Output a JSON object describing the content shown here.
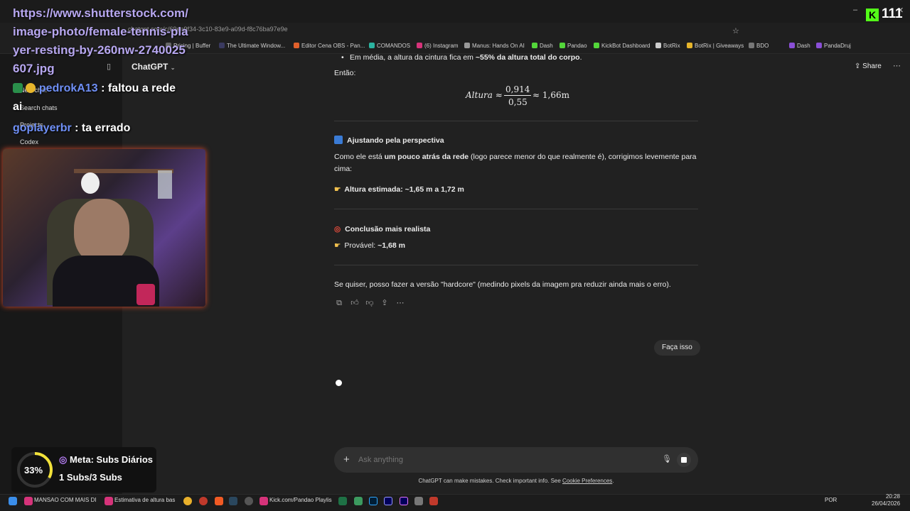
{
  "browser": {
    "url": "chatgpt.com/c/69ee9f34-3c10-83e9-a09d-f8c76ba97e9e",
    "bookmarks": [
      "Pricing | Buffer",
      "The Ultimate Window...",
      "Editor Cena OBS - Pan...",
      "COMANDOS",
      "(6) Instagram",
      "Manus: Hands On AI",
      "Dash",
      "Pandao",
      "KickBot Dashboard",
      "BotRix",
      "BotRix | Giveaways",
      "BDO",
      "Dash",
      "PandaDruj"
    ]
  },
  "overlay": {
    "url_text": "https://www.shutterstock.com/image-photo/female-tennis-player-resting-by-260nw-2740025607.jpg",
    "chat": [
      {
        "user": "pedrokA13",
        "message": ": faltou a rede ai"
      },
      {
        "user": "goplayerbr",
        "message": ": ta errado"
      }
    ],
    "kick_count": "111",
    "goal": {
      "percent_label": "33%",
      "percent": 33,
      "title": "Meta: Subs Diários",
      "progress": "1 Subs/3 Subs",
      "accent": "#f2e23a"
    }
  },
  "app": {
    "title": "ChatGPT",
    "share_label": "Share",
    "sidebar": {
      "items": [
        "New chat",
        "Search chats",
        "Projects",
        "Codex"
      ]
    }
  },
  "conversation": {
    "bullet_prefix": "Em média, a altura da cintura fica em ",
    "bullet_bold": "~55% da altura total do corpo",
    "bullet_suffix": ".",
    "entao": "Então:",
    "eq_lhs": "Altura ≈",
    "eq_num": "0,914",
    "eq_den": "0,55",
    "eq_rhs": "≈ 1,66m",
    "section1_title": "Ajustando pela perspectiva",
    "section1_pre": "Como ele está ",
    "section1_bold": "um pouco atrás da rede",
    "section1_post": " (logo parece menor do que realmente é), corrigimos levemente para cima:",
    "estimate_label": "Altura estimada: ~1,65 m a 1,72 m",
    "section2_title": "Conclusão mais realista",
    "probable_label": "Provável: ",
    "probable_value": "~1,68 m",
    "closing": "Se quiser, posso fazer a versão \"hardcore\" (medindo pixels da imagem pra reduzir ainda mais o erro).",
    "user_message": "Faça isso"
  },
  "composer": {
    "placeholder": "Ask anything",
    "disclaimer_pre": "ChatGPT can make mistakes. Check important info. See ",
    "disclaimer_link": "Cookie Preferences",
    "disclaimer_post": "."
  },
  "taskbar": {
    "items": [
      "MANSAO COM MAIS DI",
      "Estimativa de altura bas",
      "Kick.com/Pandao Playlis"
    ],
    "lang": "POR",
    "time": "20:28",
    "date": "26/04/2026"
  }
}
